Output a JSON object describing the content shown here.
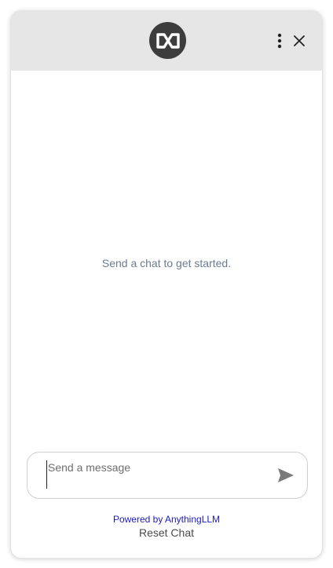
{
  "header": {
    "logo_icon": "anythingllm-logo-icon",
    "menu_icon": "vertical-dots-icon",
    "close_icon": "close-icon",
    "background": "#e6e6e6"
  },
  "chat": {
    "empty_message": "Send a chat to get started."
  },
  "composer": {
    "placeholder": "Send a message",
    "value": "",
    "send_icon": "send-icon"
  },
  "footer": {
    "powered_by": "Powered by AnythingLLM",
    "reset_label": "Reset Chat",
    "link_color": "#1a1acc"
  }
}
